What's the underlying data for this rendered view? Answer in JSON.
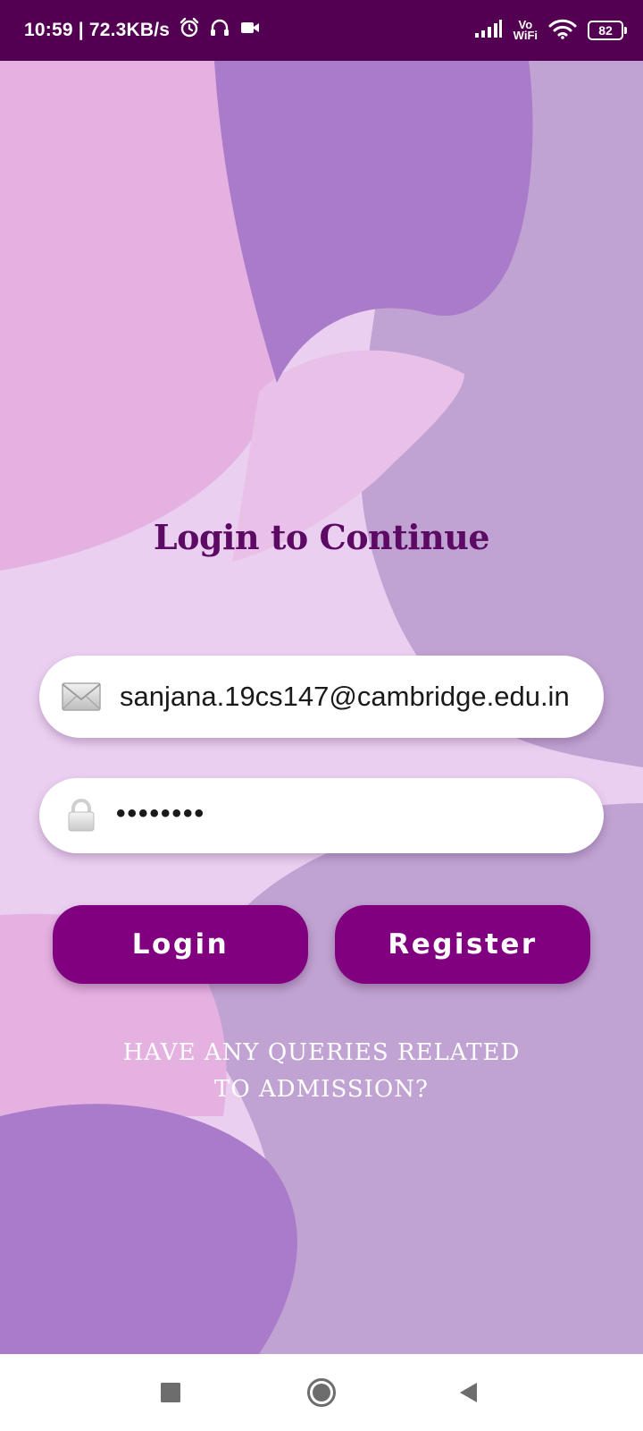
{
  "status_bar": {
    "time_speed": "10:59 | 72.3KB/s",
    "icons": [
      "alarm-icon",
      "headphones-icon",
      "video-camera-icon"
    ],
    "signal_icon": "cellular-signal-icon",
    "vowifi_top": "Vo",
    "vowifi_bottom": "WiFi",
    "wifi_icon": "wifi-icon",
    "battery_level": "82"
  },
  "login": {
    "title": "Login to Continue",
    "email_icon": "envelope-icon",
    "email_value": "sanjana.19cs147@cambridge.edu.in",
    "password_icon": "lock-icon",
    "password_value": "••••••••",
    "login_label": "Login",
    "register_label": "Register",
    "queries_line1": "HAVE ANY QUERIES RELATED",
    "queries_line2": "TO ADMISSION?"
  },
  "nav_bar": {
    "recents_icon": "square-icon",
    "home_icon": "circle-home-icon",
    "back_icon": "triangle-back-icon"
  },
  "colors": {
    "status_bar": "#540052",
    "title": "#5c0a63",
    "button": "#800080",
    "blob_violet": "#a97bca",
    "blob_lavender": "#c0a3d2",
    "blob_pink": "#e5b1e1",
    "blob_light": "#ebcff1"
  }
}
